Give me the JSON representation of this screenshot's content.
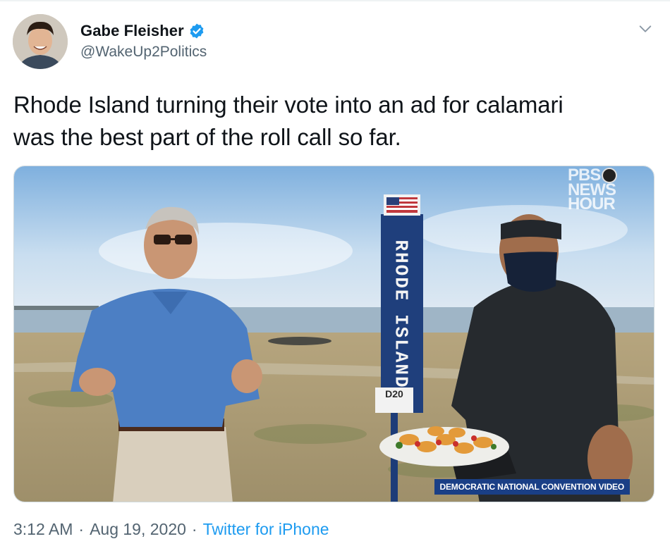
{
  "author": {
    "display_name": "Gabe Fleisher",
    "handle": "@WakeUp2Politics",
    "verified": true
  },
  "tweet": {
    "text_line_1": "Rhode Island turning their vote into an ad for calamari",
    "text_line_2": "was the best part of the roll call so far."
  },
  "media": {
    "network_logo": [
      "PBS",
      "NEWS",
      "HOUR"
    ],
    "sign_label": "RHODE ISLAND",
    "sign_badge": "D20",
    "caption": "DEMOCRATIC NATIONAL CONVENTION VIDEO"
  },
  "meta": {
    "time": "3:12 AM",
    "separator": "·",
    "date": "Aug 19, 2020",
    "source": "Twitter for iPhone"
  },
  "colors": {
    "link": "#1d9bf0",
    "secondary_text": "#536471",
    "verified_badge": "#1d9bf0",
    "caption_bg": "#1a3f86"
  },
  "icons": {
    "verified": "verified-badge-icon",
    "more": "chevron-down-icon",
    "pbs": "pbs-head-icon"
  }
}
